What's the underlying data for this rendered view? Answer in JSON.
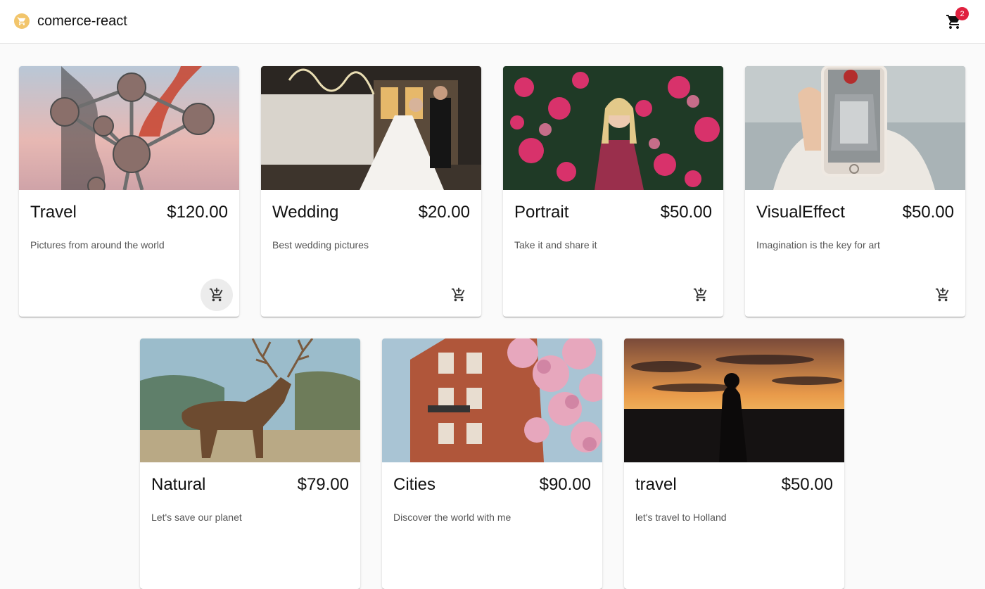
{
  "app": {
    "title": "comerce-react",
    "cart_count": "2",
    "brand_color": "#f2c56b",
    "badge_color": "#e0213f"
  },
  "products": [
    {
      "title": "Travel",
      "price": "$120.00",
      "description": "Pictures from around the world",
      "image": "atomium-smoke-photo"
    },
    {
      "title": "Wedding",
      "price": "$20.00",
      "description": "Best wedding pictures",
      "image": "wedding-couple-photo"
    },
    {
      "title": "Portrait",
      "price": "$50.00",
      "description": "Take it and share it",
      "image": "portrait-flowers-photo"
    },
    {
      "title": "VisualEffect",
      "price": "$50.00",
      "description": "Imagination is the key for art",
      "image": "phone-sweater-photo"
    },
    {
      "title": "Natural",
      "price": "$79.00",
      "description": "Let's save our planet",
      "image": "deer-field-photo"
    },
    {
      "title": "Cities",
      "price": "$90.00",
      "description": "Discover the world with me",
      "image": "building-blossom-photo"
    },
    {
      "title": "travel",
      "price": "$50.00",
      "description": "let's travel to Holland",
      "image": "sunset-silhouette-photo"
    }
  ]
}
